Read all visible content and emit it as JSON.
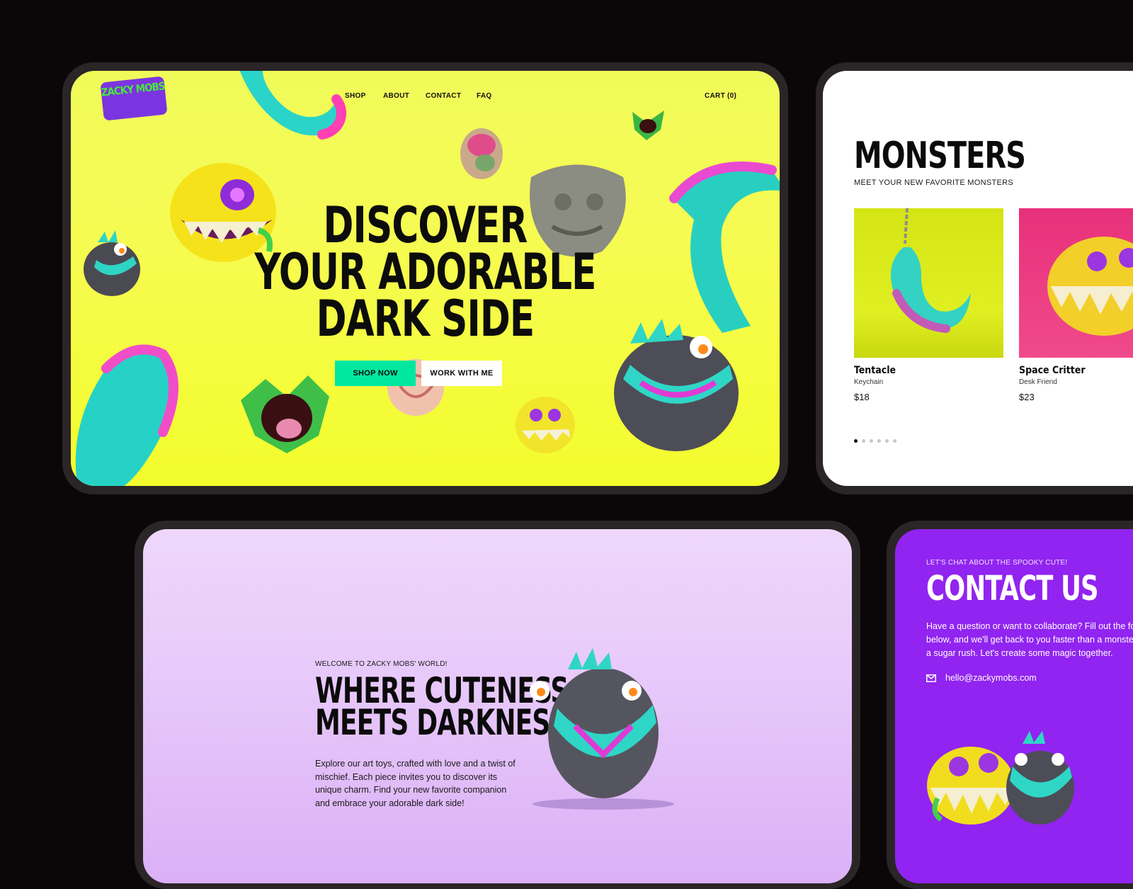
{
  "hero": {
    "logo": "ZACKY MOBS",
    "nav": [
      "SHOP",
      "ABOUT",
      "CONTACT",
      "FAQ"
    ],
    "cart": "CART (0)",
    "title_lines": [
      "DISCOVER",
      "YOUR ADORABLE",
      "DARK SIDE"
    ],
    "shop_now": "SHOP NOW",
    "work_with_me": "WORK WITH ME",
    "colors": {
      "background": "#f3fc2c",
      "shop_button": "#00e8a0"
    }
  },
  "monsters": {
    "title": "MONSTERS",
    "subtitle": "MEET YOUR NEW FAVORITE MONSTERS",
    "products": [
      {
        "name": "Tentacle",
        "type": "Keychain",
        "price": "$18"
      },
      {
        "name": "Space Critter",
        "type": "Desk Friend",
        "price": "$23"
      }
    ],
    "carousel": {
      "count": 6,
      "active": 1
    }
  },
  "about": {
    "eyebrow": "WELCOME TO ZACKY MOBS' WORLD!",
    "title_lines": [
      "WHERE CUTENESS",
      "MEETS DARKNESS"
    ],
    "body": "Explore our art toys, crafted with love and a twist of mischief. Each piece invites you to discover its unique charm. Find your new favorite companion and embrace your adorable dark side!"
  },
  "contact": {
    "eyebrow": "LET'S CHAT ABOUT THE SPOOKY CUTE!",
    "title": "CONTACT US",
    "body": "Have a question or want to collaborate? Fill out the form below, and we'll get back to you faster than a monster on a sugar rush. Let's create some magic together.",
    "email": "hello@zackymobs.com",
    "colors": {
      "background": "#9124f0"
    }
  }
}
